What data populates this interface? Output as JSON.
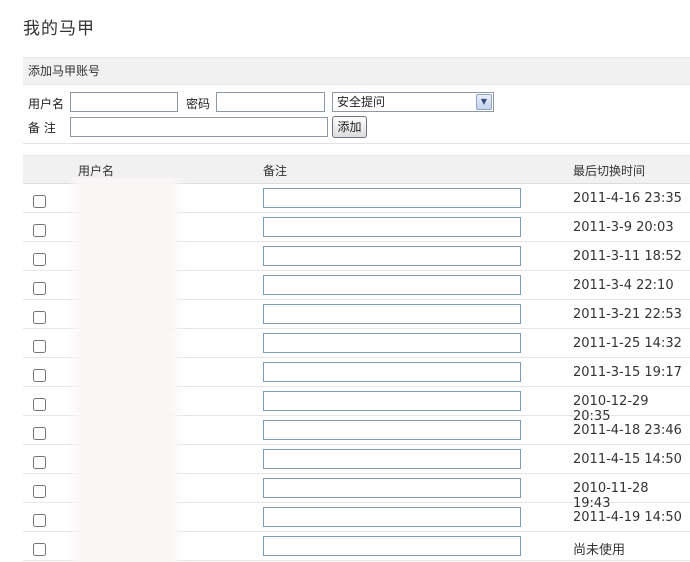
{
  "page": {
    "title": "我的马甲"
  },
  "add_form": {
    "header": "添加马甲账号",
    "username_label": "用户名",
    "username_value": "",
    "password_label": "密码",
    "password_value": "",
    "security_question": "安全提问",
    "note_label": "备 注",
    "note_value": "",
    "add_button": "添加"
  },
  "table": {
    "columns": [
      "用户名",
      "备注",
      "最后切换时间"
    ],
    "rows": [
      {
        "username": "",
        "note": "",
        "last_switch": "2011-4-16 23:35"
      },
      {
        "username": "",
        "note": "",
        "last_switch": "2011-3-9 20:03"
      },
      {
        "username": "",
        "note": "",
        "last_switch": "2011-3-11 18:52"
      },
      {
        "username": "",
        "note": "",
        "last_switch": "2011-3-4 22:10"
      },
      {
        "username": "",
        "note": "",
        "last_switch": "2011-3-21 22:53"
      },
      {
        "username": "",
        "note": "",
        "last_switch": "2011-1-25 14:32"
      },
      {
        "username": "",
        "note": "",
        "last_switch": "2011-3-15 19:17"
      },
      {
        "username": "",
        "note": "",
        "last_switch": "2010-12-29 20:35"
      },
      {
        "username": "",
        "note": "",
        "last_switch": "2011-4-18 23:46"
      },
      {
        "username": "",
        "note": "",
        "last_switch": "2011-4-15 14:50"
      },
      {
        "username": "",
        "note": "",
        "last_switch": "2010-11-28 19:43"
      },
      {
        "username": "",
        "note": "",
        "last_switch": "2011-4-19 14:50"
      },
      {
        "username": "",
        "note": "",
        "last_switch": "尚未使用"
      }
    ]
  }
}
